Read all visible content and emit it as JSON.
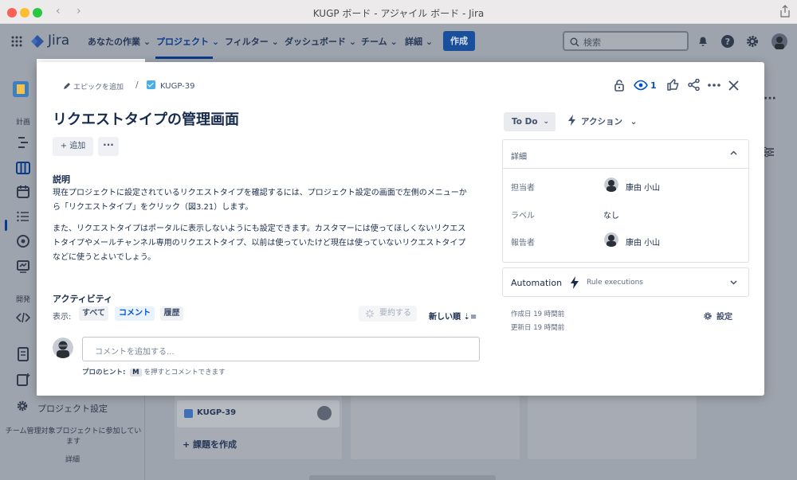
{
  "window": {
    "title": "KUGP ボード - アジャイル ボード - Jira"
  },
  "topnav": {
    "logo": "Jira",
    "items": [
      "あなたの作業",
      "プロジェクト",
      "フィルター",
      "ダッシュボード",
      "チーム",
      "詳細"
    ],
    "create_label": "作成",
    "search_placeholder": "検索"
  },
  "sidebar": {
    "section_plan": "計画",
    "section_dev": "開発",
    "project_settings": "プロジェクト設定",
    "note": "チーム管理対象プロジェクトに参加しています",
    "detail_link": "詳細"
  },
  "board": {
    "card_key": "KUGP-39",
    "create_issue": "課題を作成"
  },
  "issue": {
    "breadcrumb_epic": "エピックを追加",
    "breadcrumb_sep": "/",
    "key": "KUGP-39",
    "watch_count": "1",
    "title": "リクエストタイプの管理画面",
    "add_label": "追加",
    "more_label": "···",
    "description_heading": "説明",
    "description": [
      "現在プロジェクトに設定されているリクエストタイプを確認するには、プロジェクト設定の画面で左側のメニューから「リクエストタイプ」をクリック（図3.21）します。",
      "また、リクエストタイプはポータルに表示しないようにも設定できます。カスタマーには使ってほしくないリクエストタイプやメールチャンネル専用のリクエストタイプ、以前は使っていたけど現在は使っていないリクエストタイプなどに使うとよいでしょう。"
    ],
    "activity_heading": "アクティビティ",
    "show_label": "表示:",
    "filters": [
      "すべて",
      "コメント",
      "履歴"
    ],
    "summarize_label": "要約する",
    "sort_label": "新しい順",
    "comment_placeholder": "コメントを追加する...",
    "protip_prefix": "プロのヒント:",
    "protip_key": "M",
    "protip_suffix": "を押すとコメントできます"
  },
  "panel": {
    "status": "To Do",
    "action": "アクション",
    "details_title": "詳細",
    "assignee_label": "担当者",
    "assignee_name": "康由 小山",
    "labels_label": "ラベル",
    "labels_value": "なし",
    "reporter_label": "報告者",
    "reporter_name": "康由 小山",
    "automation_label": "Automation",
    "rule_executions": "Rule executions",
    "created": "作成日 19 時間前",
    "updated": "更新日 19 時間前",
    "settings": "設定"
  },
  "colors": {
    "accent": "#0052cc",
    "overlay": "#9ea4ad",
    "text": "#172b4d"
  },
  "icons": [
    "grid-icon",
    "search-icon",
    "bell-icon",
    "help-icon",
    "gear-icon",
    "pencil-icon",
    "lock-icon",
    "eye-icon",
    "like-icon",
    "share-icon",
    "close-icon",
    "bolt-icon"
  ]
}
